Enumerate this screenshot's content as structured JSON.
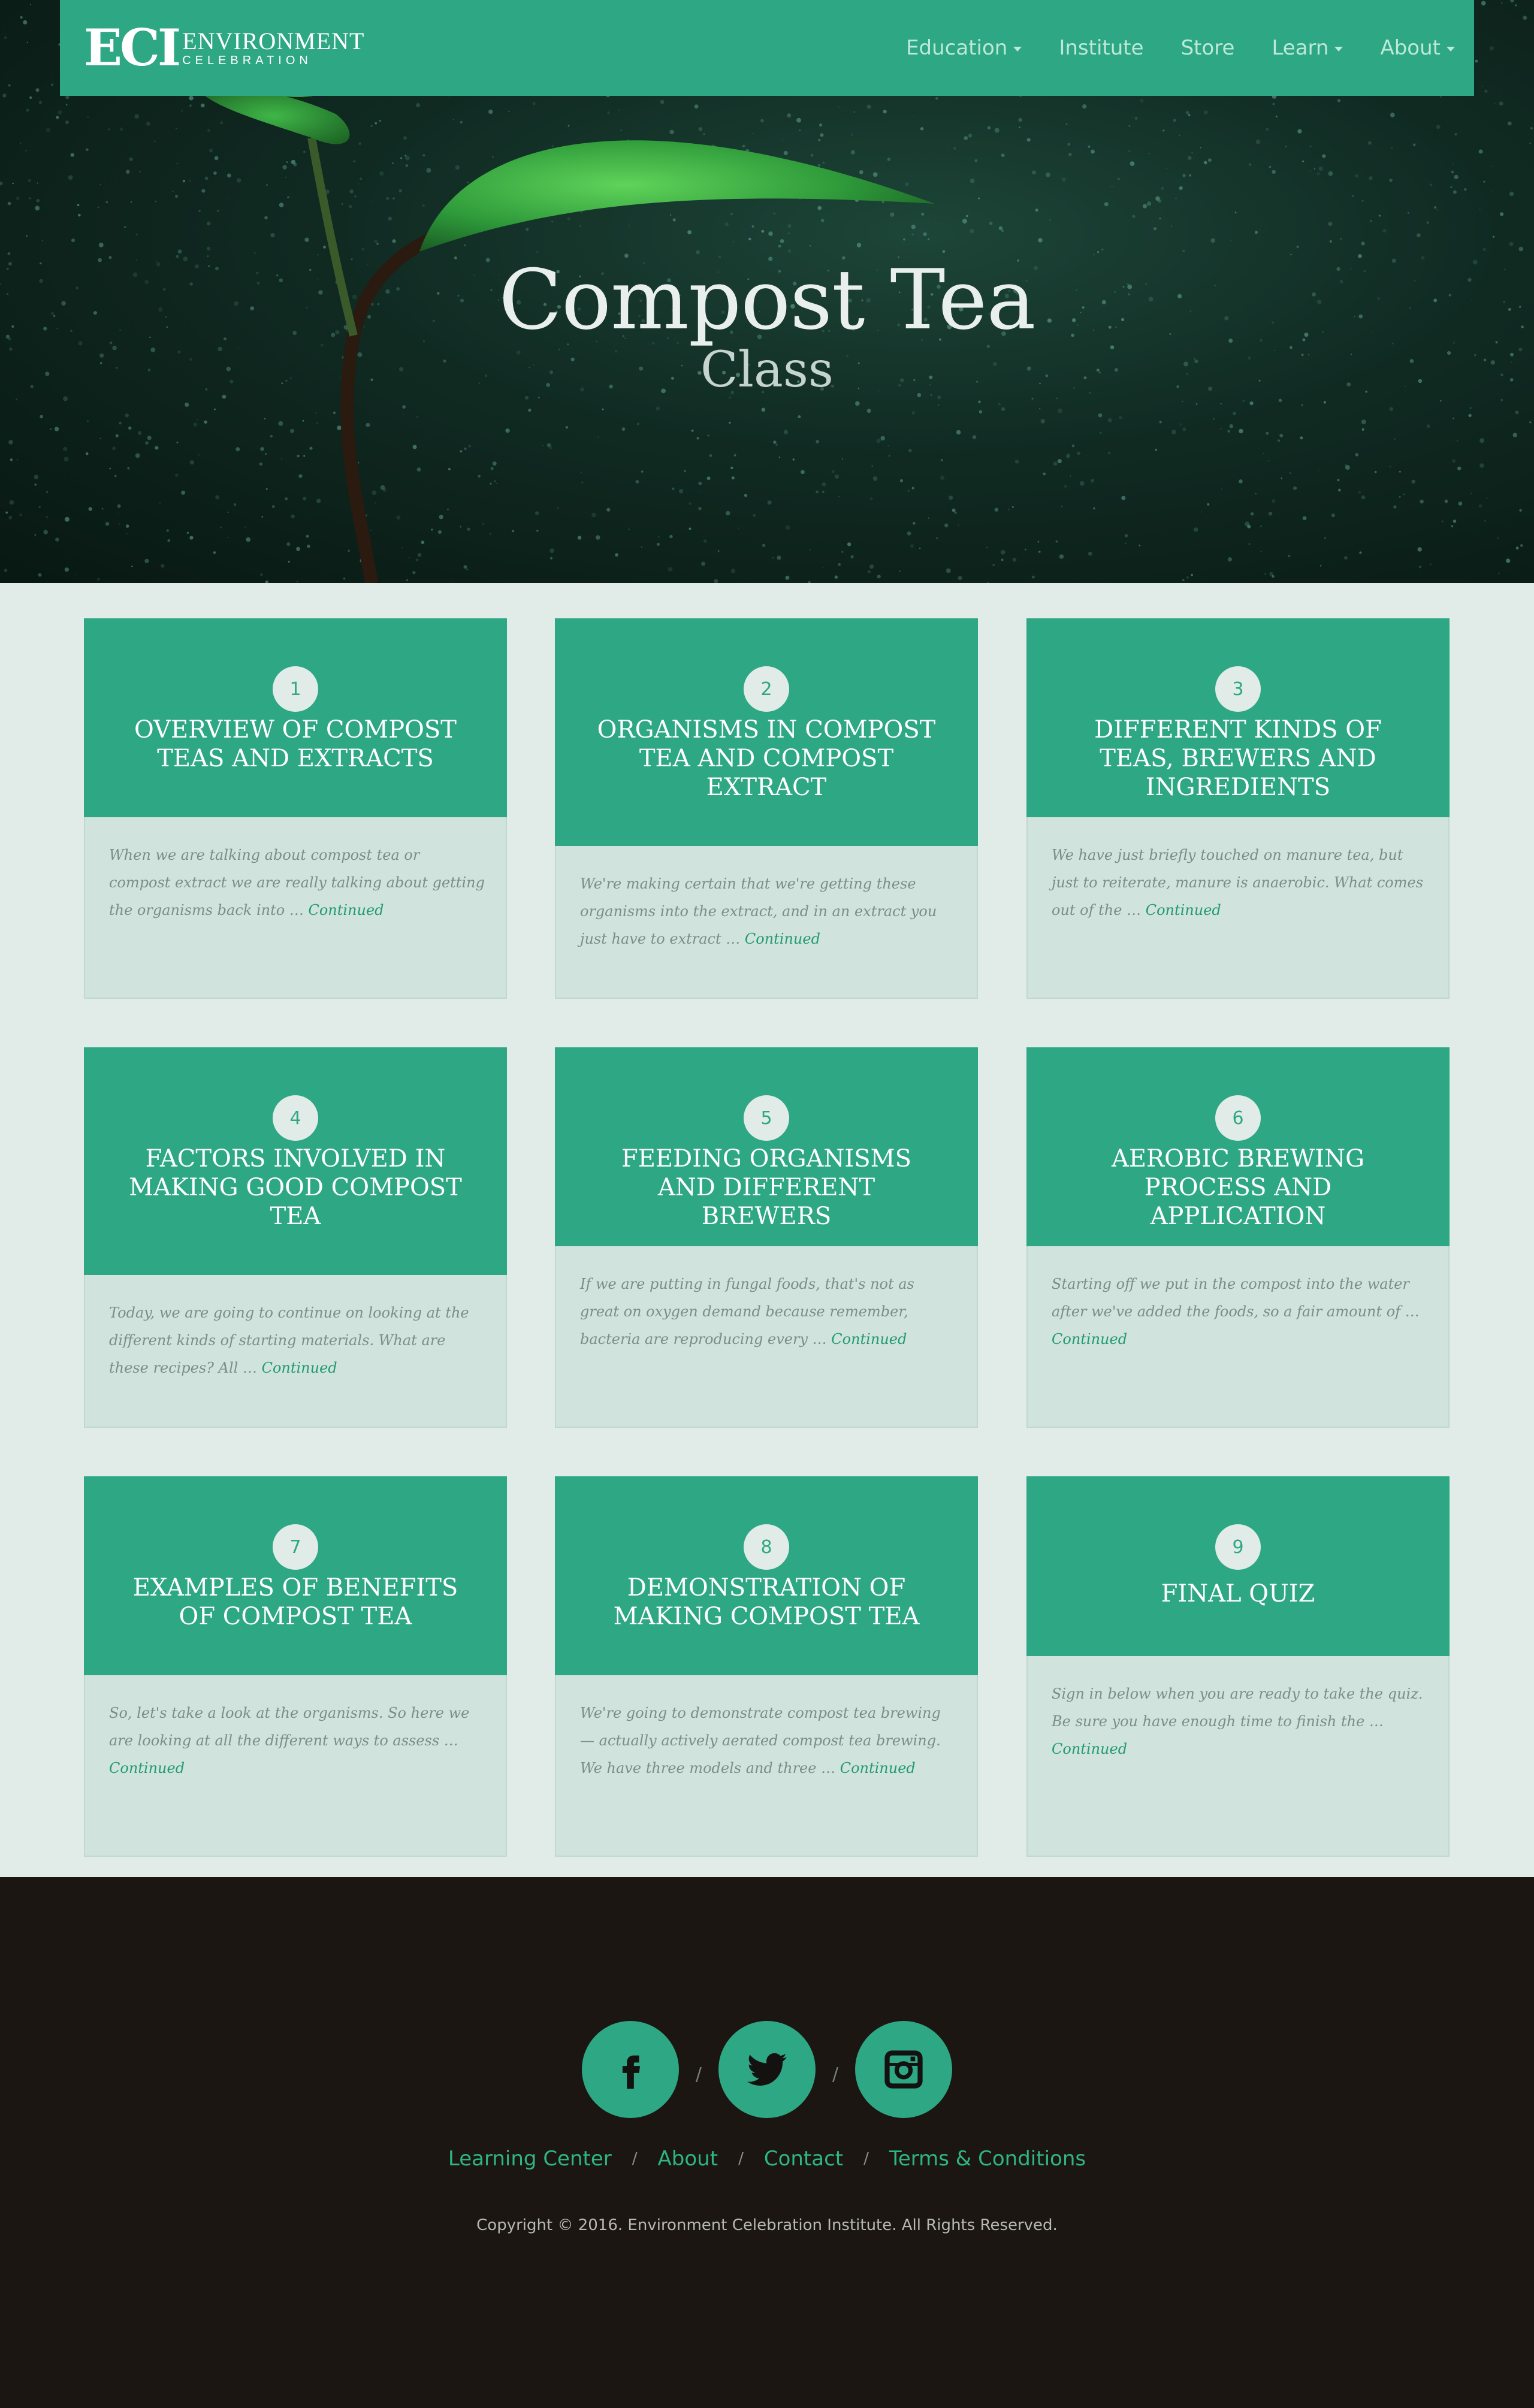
{
  "brand": {
    "mark": "ECI",
    "line1": "ENVIRONMENT",
    "line2": "CELEBRATION"
  },
  "nav": [
    {
      "label": "Education",
      "dropdown": true
    },
    {
      "label": "Institute",
      "dropdown": false
    },
    {
      "label": "Store",
      "dropdown": false
    },
    {
      "label": "Learn",
      "dropdown": true
    },
    {
      "label": "About",
      "dropdown": true
    }
  ],
  "hero": {
    "title": "Compost Tea",
    "subtitle": "Class"
  },
  "lessons": [
    {
      "number": "1",
      "title": "OVERVIEW OF COMPOST TEAS AND EXTRACTS",
      "excerpt": "When we are talking about compost tea or compost extract we are really talking about getting the organisms back into … ",
      "link": "Continued"
    },
    {
      "number": "2",
      "title": "ORGANISMS IN COMPOST TEA AND COMPOST EXTRACT",
      "excerpt": "We're making certain that we're getting these organisms into the extract, and in an extract you just have to extract … ",
      "link": "Continued"
    },
    {
      "number": "3",
      "title": "DIFFERENT KINDS OF TEAS, BREWERS AND INGREDIENTS",
      "excerpt": "We have just briefly touched on manure tea, but just to reiterate, manure is anaerobic.  What comes out of the … ",
      "link": "Continued"
    },
    {
      "number": "4",
      "title": "FACTORS INVOLVED IN MAKING GOOD COMPOST TEA",
      "excerpt": "Today, we are going to continue on looking at the different kinds of starting materials.  What are these recipes?  All … ",
      "link": "Continued"
    },
    {
      "number": "5",
      "title": "FEEDING ORGANISMS AND DIFFERENT BREWERS",
      "excerpt": "If we are putting in fungal foods, that's not as great on oxygen demand because remember, bacteria are reproducing every … ",
      "link": "Continued"
    },
    {
      "number": "6",
      "title": "AEROBIC BREWING PROCESS AND APPLICATION",
      "excerpt": "Starting off we put in the compost into the water after we've added the foods, so a fair amount of … ",
      "link": "Continued"
    },
    {
      "number": "7",
      "title": "EXAMPLES OF BENEFITS OF COMPOST TEA",
      "excerpt": "So, let's take a look at the organisms.  So here we are looking at all the different ways to assess … ",
      "link": "Continued"
    },
    {
      "number": "8",
      "title": "DEMONSTRATION OF MAKING COMPOST TEA",
      "excerpt": "We're going to demonstrate compost tea brewing — actually actively aerated compost tea brewing. We have three models and three … ",
      "link": "Continued"
    },
    {
      "number": "9",
      "title": "FINAL QUIZ",
      "excerpt": "Sign in below when you are ready to take the quiz. Be sure you have enough time to finish the … ",
      "link": "Continued"
    }
  ],
  "footer": {
    "social": [
      "facebook-icon",
      "twitter-icon",
      "instagram-icon"
    ],
    "social_sep": "/",
    "links": [
      "Learning Center",
      "About",
      "Contact",
      "Terms & Conditions"
    ],
    "link_sep": "/",
    "copyright": "Copyright © 2016. Environment Celebration Institute. All Rights Reserved."
  },
  "colors": {
    "brand_green": "#2ea884",
    "page_bg": "#e1ebe8",
    "card_bg": "#d0e3dd",
    "footer_bg": "#1b1611",
    "link_green": "#229a74"
  }
}
